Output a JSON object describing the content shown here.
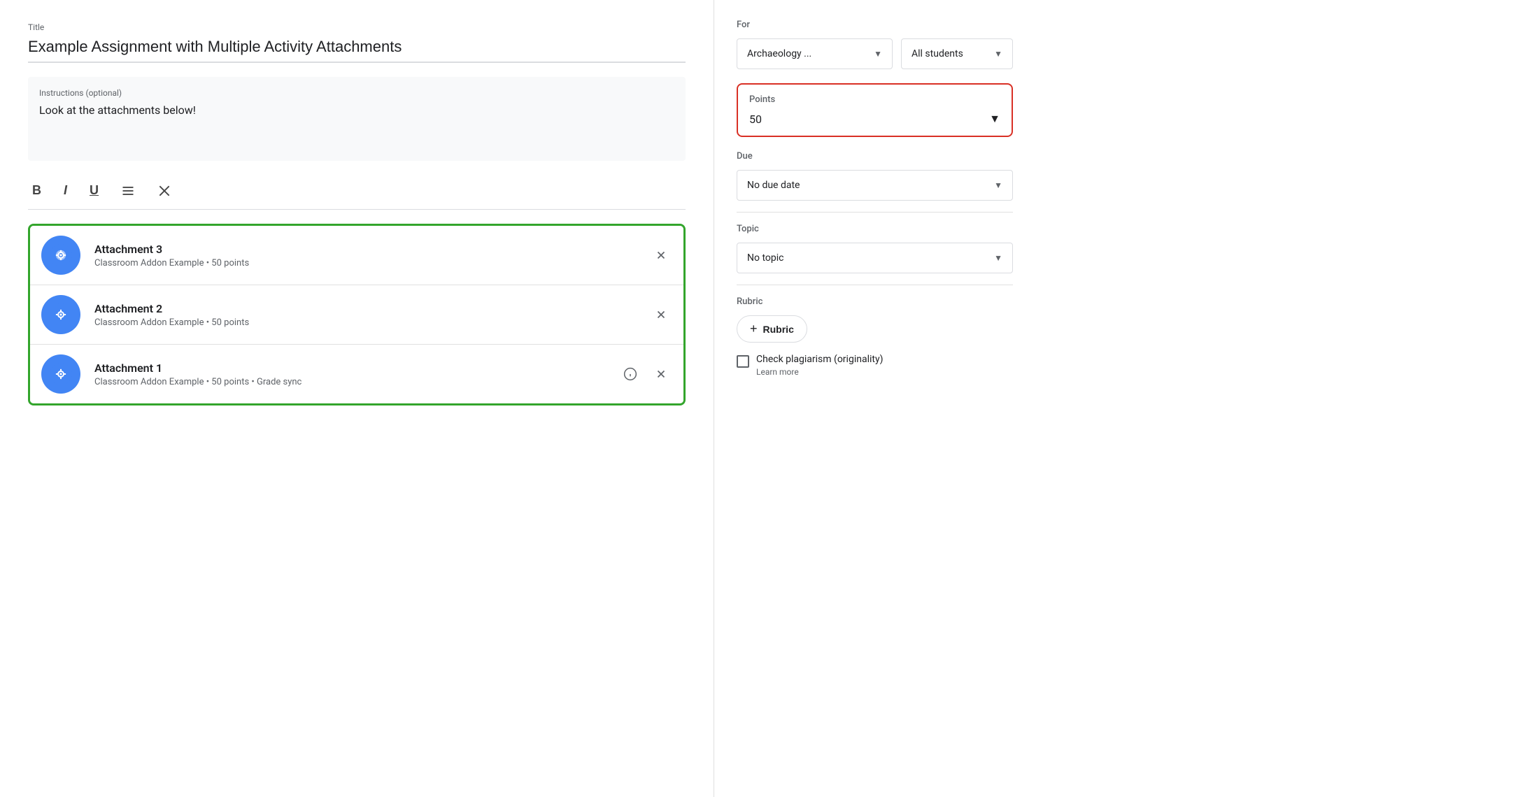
{
  "left": {
    "title_label": "Title",
    "title_value": "Example Assignment with Multiple Activity Attachments",
    "instructions_label": "Instructions (optional)",
    "instructions_value": "Look at the attachments below!",
    "toolbar": {
      "bold": "B",
      "italic": "I",
      "underline": "U",
      "list": "≡",
      "clear": "✕"
    },
    "attachments": [
      {
        "name": "Attachment 3",
        "meta": "Classroom Addon Example • 50 points",
        "has_info": false
      },
      {
        "name": "Attachment 2",
        "meta": "Classroom Addon Example • 50 points",
        "has_info": false
      },
      {
        "name": "Attachment 1",
        "meta": "Classroom Addon Example • 50 points • Grade sync",
        "has_info": true
      }
    ]
  },
  "right": {
    "for_label": "For",
    "class_name": "Archaeology ...",
    "students": "All students",
    "points_label": "Points",
    "points_value": "50",
    "due_label": "Due",
    "due_value": "No due date",
    "topic_label": "Topic",
    "topic_value": "No topic",
    "rubric_label": "Rubric",
    "rubric_btn": "Rubric",
    "plagiarism_label": "Check plagiarism (originality)",
    "learn_more": "Learn more"
  }
}
